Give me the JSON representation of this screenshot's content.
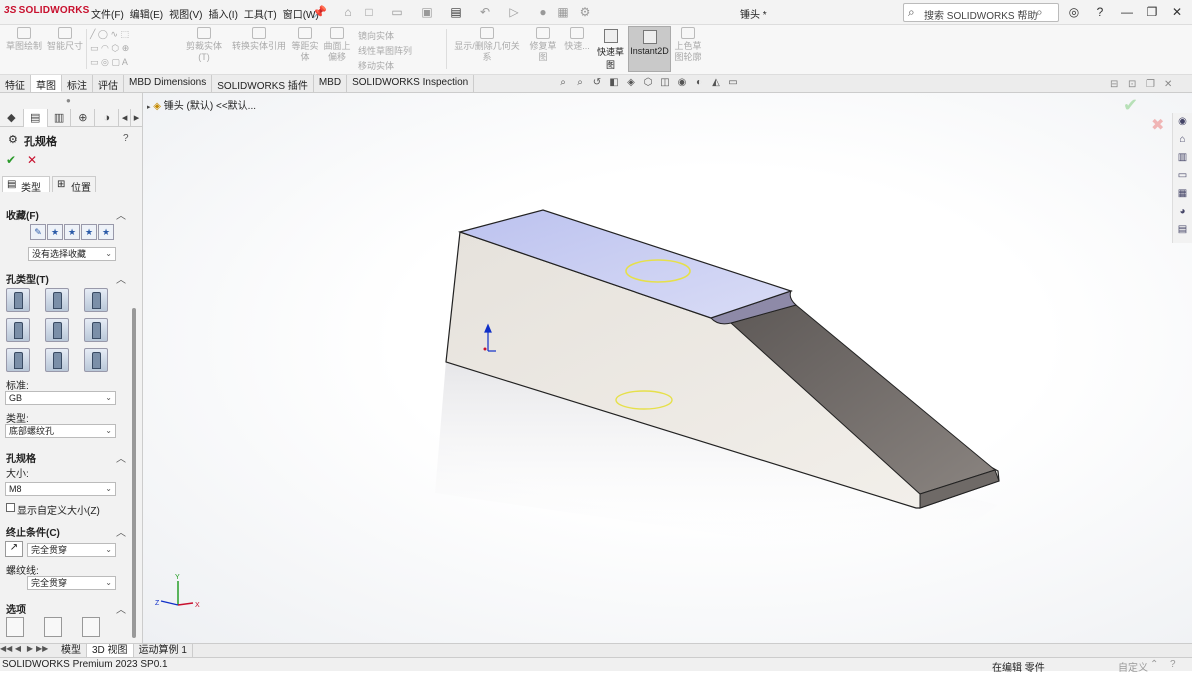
{
  "app": {
    "logo_prefix": "3S",
    "logo_text": "SOLIDWORKS",
    "doc_title": "锤头 *",
    "search_placeholder": "搜索 SOLIDWORKS 帮助"
  },
  "menu": [
    "文件(F)",
    "编辑(E)",
    "视图(V)",
    "插入(I)",
    "工具(T)",
    "窗口(W)"
  ],
  "ribbon": {
    "sketch_draw": "草图绘制",
    "smart_dim": "智能尺寸",
    "trim": "剪裁实体(T)",
    "convert": "转换实体引用",
    "offset": "等距实体",
    "surface_offset": "曲面上偏移",
    "mirror": "镜向实体",
    "linear_pattern": "线性草图阵列",
    "move": "移动实体",
    "show_relations": "显示/删除几何关系",
    "repair": "修复草图",
    "quick_snap": "快速...",
    "rapid_sketch": "快速草图",
    "instant2d": "Instant2D",
    "shaded_sketch": "上色草图轮廓"
  },
  "tabs": [
    "特征",
    "草图",
    "标注",
    "评估",
    "MBD Dimensions",
    "SOLIDWORKS 插件",
    "MBD",
    "SOLIDWORKS Inspection"
  ],
  "active_tab": "草图",
  "feature_tree": {
    "root": "锤头 (默认) <<默认..."
  },
  "property_manager": {
    "title": "孔规格",
    "subtabs": [
      "类型",
      "位置"
    ],
    "favorites_label": "收藏(F)",
    "favorites_value": "没有选择收藏",
    "hole_type_label": "孔类型(T)",
    "standard_label": "标准:",
    "standard_value": "GB",
    "type_label": "类型:",
    "type_value": "底部螺纹孔",
    "spec_label": "孔规格",
    "size_label": "大小:",
    "size_value": "M8",
    "custom_size_label": "显示自定义大小(Z)",
    "end_condition_label": "终止条件(C)",
    "end_condition_value": "完全贯穿",
    "thread_label": "螺纹线:",
    "thread_value": "完全贯穿",
    "options_label": "选项"
  },
  "bottom_tabs": [
    "模型",
    "3D 视图",
    "运动算例 1"
  ],
  "status": {
    "left": "SOLIDWORKS Premium 2023 SP0.1",
    "editing": "在编辑 零件",
    "custom": "自定义"
  },
  "triad": {
    "x": "X",
    "y": "Y",
    "z": "Z"
  },
  "colors": {
    "accent": "#c8102e",
    "top_face": "#c9cdf0",
    "side_face": "#ede9e3",
    "slope_face": "#7a7470"
  }
}
